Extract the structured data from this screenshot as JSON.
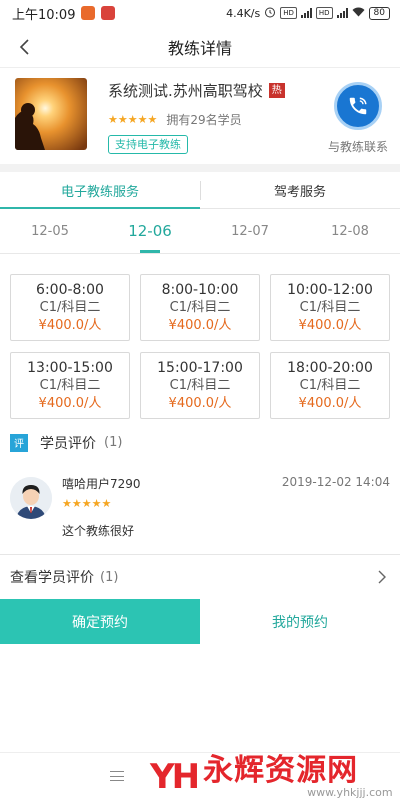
{
  "status_bar": {
    "time": "上午10:09",
    "speed": "4.4K/s",
    "hd1": "HD",
    "hd2": "HD",
    "net1": "4G",
    "net2": "4G",
    "battery": "80"
  },
  "nav": {
    "title": "教练详情"
  },
  "coach": {
    "name": "系统测试.苏州高职驾校",
    "hot_badge": "热",
    "rating": 5,
    "students_text": "拥有29名学员",
    "support_tag": "支持电子教练",
    "contact_label": "与教练联系"
  },
  "tabs": [
    {
      "label": "电子教练服务",
      "active": true
    },
    {
      "label": "驾考服务",
      "active": false
    }
  ],
  "dates": [
    {
      "label": "12-05",
      "active": false
    },
    {
      "label": "12-06",
      "active": true
    },
    {
      "label": "12-07",
      "active": false
    },
    {
      "label": "12-08",
      "active": false
    }
  ],
  "slots": [
    {
      "time": "6:00-8:00",
      "type": "C1/科目二",
      "price": "¥400.0",
      "unit": "/人"
    },
    {
      "time": "8:00-10:00",
      "type": "C1/科目二",
      "price": "¥400.0",
      "unit": "/人"
    },
    {
      "time": "10:00-12:00",
      "type": "C1/科目二",
      "price": "¥400.0",
      "unit": "/人"
    },
    {
      "time": "13:00-15:00",
      "type": "C1/科目二",
      "price": "¥400.0",
      "unit": "/人"
    },
    {
      "time": "15:00-17:00",
      "type": "C1/科目二",
      "price": "¥400.0",
      "unit": "/人"
    },
    {
      "time": "18:00-20:00",
      "type": "C1/科目二",
      "price": "¥400.0",
      "unit": "/人"
    }
  ],
  "reviews_section": {
    "badge": "评",
    "title": "学员评价",
    "count": "(1)"
  },
  "review": {
    "user": "嘻哈用户7290",
    "date": "2019-12-02 14:04",
    "rating": 5,
    "text": "这个教练很好"
  },
  "view_all": {
    "label": "查看学员评价",
    "count": "(1)"
  },
  "actions": {
    "confirm": "确定预约",
    "mine": "我的预约"
  },
  "watermark": {
    "logo": "YH",
    "name": "永辉资源网",
    "url": "www.yhkjjj.com"
  },
  "colors": {
    "accent": "#2cc4b3",
    "price": "#e56a1e",
    "hot": "#c8332d",
    "phone": "#1976d2",
    "star": "#f5a623"
  }
}
